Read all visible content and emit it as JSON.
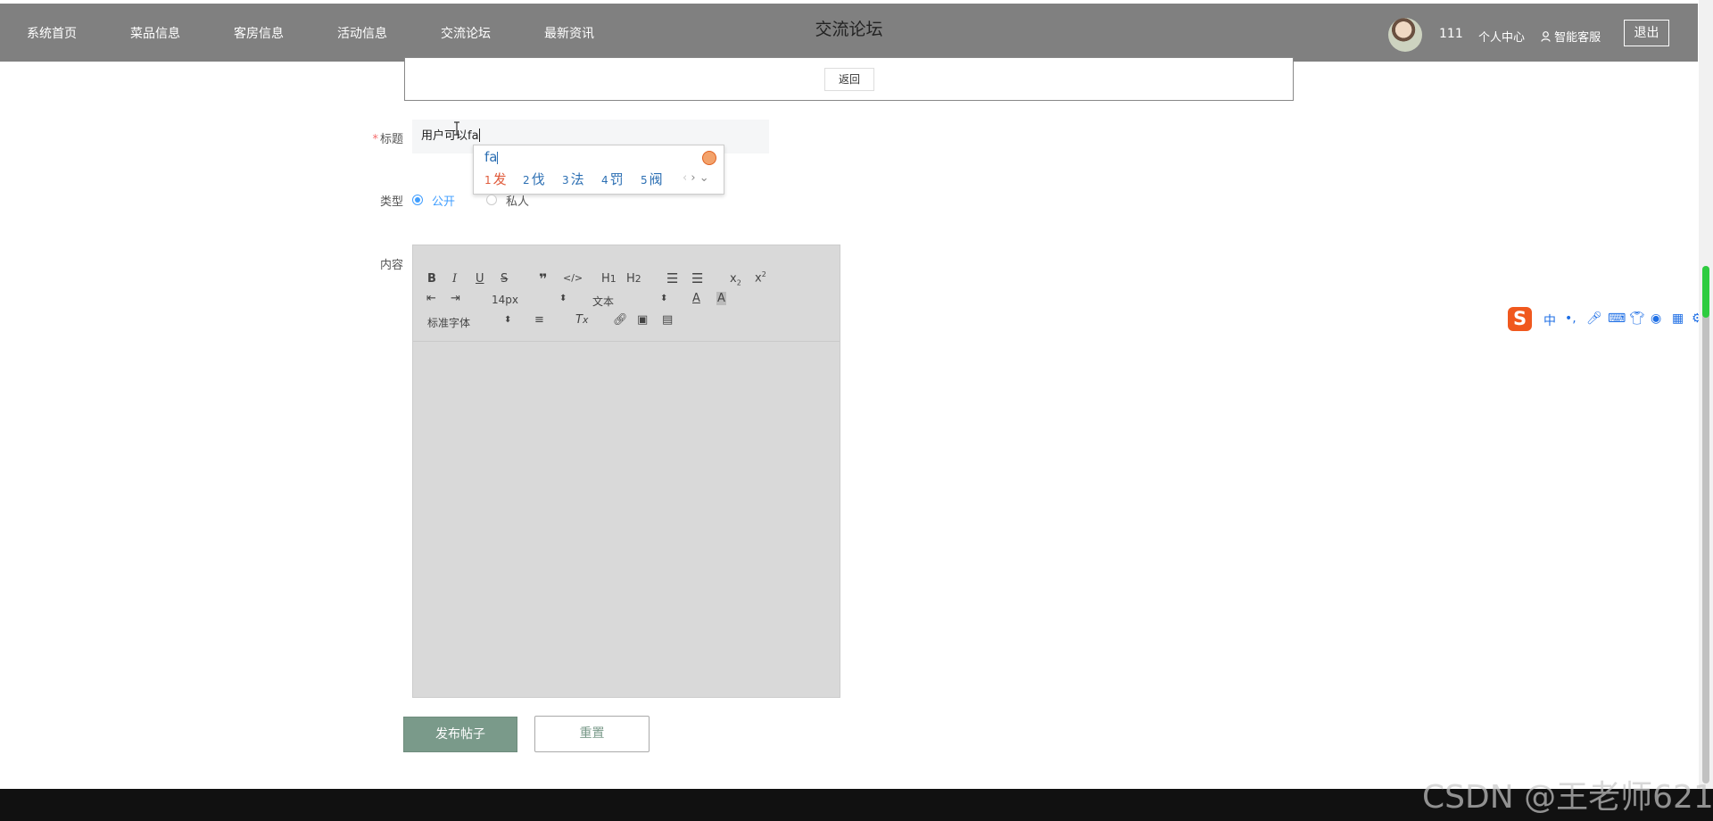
{
  "nav": {
    "items": [
      {
        "label": "系统首页"
      },
      {
        "label": "菜品信息"
      },
      {
        "label": "客房信息"
      },
      {
        "label": "活动信息"
      },
      {
        "label": "交流论坛"
      },
      {
        "label": "最新资讯"
      }
    ],
    "page_title": "交流论坛",
    "user_name": "111",
    "personal_center": "个人中心",
    "smart_service": "智能客服",
    "logout": "退出"
  },
  "back_button": "返回",
  "form": {
    "title_label": "标题",
    "title_required_mark": "*",
    "title_value": "用户可以fa",
    "type_label": "类型",
    "type_options": [
      {
        "label": "公开",
        "selected": true
      },
      {
        "label": "私人",
        "selected": false
      }
    ],
    "content_label": "内容",
    "editor": {
      "font_size": "14px",
      "header_select": "文本",
      "font_family": "标准字体"
    },
    "submit_label": "发布帖子",
    "reset_label": "重置"
  },
  "ime_popup": {
    "input": "fa",
    "candidates": [
      {
        "n": "1",
        "text": "发"
      },
      {
        "n": "2",
        "text": "伐"
      },
      {
        "n": "3",
        "text": "法"
      },
      {
        "n": "4",
        "text": "罚"
      },
      {
        "n": "5",
        "text": "阀"
      }
    ]
  },
  "ime_toolbar": {
    "logo": "S",
    "mode": "中"
  },
  "watermark": "CSDN @王老师621",
  "colors": {
    "topbar": "#808080",
    "primary_button": "#7a9a8a",
    "radio_accent": "#409eff"
  }
}
